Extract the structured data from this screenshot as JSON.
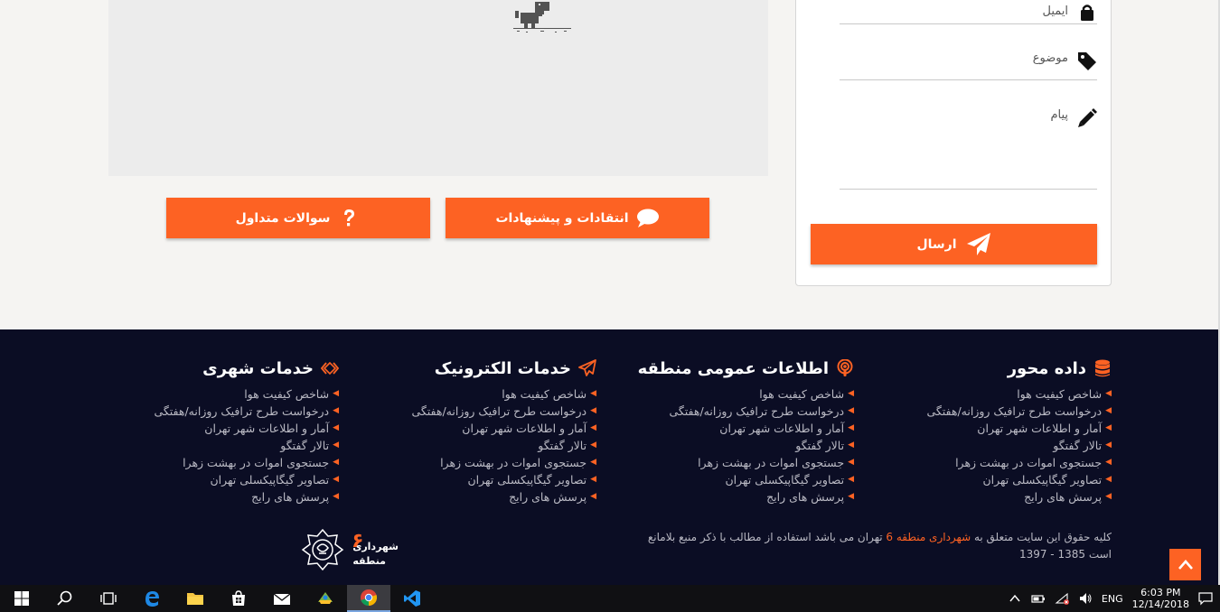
{
  "buttons": {
    "critique": "انتقادات و پیشنهادات",
    "faq": "سوالات متداول"
  },
  "form": {
    "email_label": "ایمیل",
    "subject_label": "موضوع",
    "message_label": "پیام",
    "send_label": "ارسال"
  },
  "footer": {
    "columns": [
      {
        "title": "داده محور",
        "icon": "database-icon",
        "items": [
          "شاخص کیفیت هوا",
          "درخواست طرح ترافیک روزانه/هفتگی",
          "آمار و اطلاعات شهر تهران",
          "تالار گفتگو",
          "جستجوی اموات در بهشت زهرا",
          "تصاویر گیگاپیکسلی تهران",
          "پرسش های رایج"
        ]
      },
      {
        "title": "اطلاعات عمومی منطقه",
        "icon": "podcast-icon",
        "items": [
          "شاخص کیفیت هوا",
          "درخواست طرح ترافیک روزانه/هفتگی",
          "آمار و اطلاعات شهر تهران",
          "تالار گفتگو",
          "جستجوی اموات در بهشت زهرا",
          "تصاویر گیگاپیکسلی تهران",
          "پرسش های رایج"
        ]
      },
      {
        "title": "خدمات الکترونیک",
        "icon": "paper-plane-icon",
        "items": [
          "شاخص کیفیت هوا",
          "درخواست طرح ترافیک روزانه/هفتگی",
          "آمار و اطلاعات شهر تهران",
          "تالار گفتگو",
          "جستجوی اموات در بهشت زهرا",
          "تصاویر گیگاپیکسلی تهران",
          "پرسش های رایج"
        ]
      },
      {
        "title": "خدمات شهری",
        "icon": "code-icon",
        "items": [
          "شاخص کیفیت هوا",
          "درخواست طرح ترافیک روزانه/هفتگی",
          "آمار و اطلاعات شهر تهران",
          "تالار گفتگو",
          "جستجوی اموات در بهشت زهرا",
          "تصاویر گیگاپیکسلی تهران",
          "پرسش های رایج"
        ]
      }
    ],
    "copyright_pre": "کلیه حقوق این سایت متعلق به ",
    "copyright_org": "شهرداری منطقه 6",
    "copyright_post": " تهران می باشد استفاده از مطالب با ذکر منبع بلامانع است 1385 - 1397",
    "logo_text_1": "شهرداری",
    "logo_text_2": "منطقه",
    "logo_number": "۶"
  },
  "taskbar": {
    "lang": "ENG",
    "time": "6:03 PM",
    "date": "12/14/2018"
  },
  "colors": {
    "accent": "#fd6223",
    "footer_bg": "#0b0d24"
  }
}
